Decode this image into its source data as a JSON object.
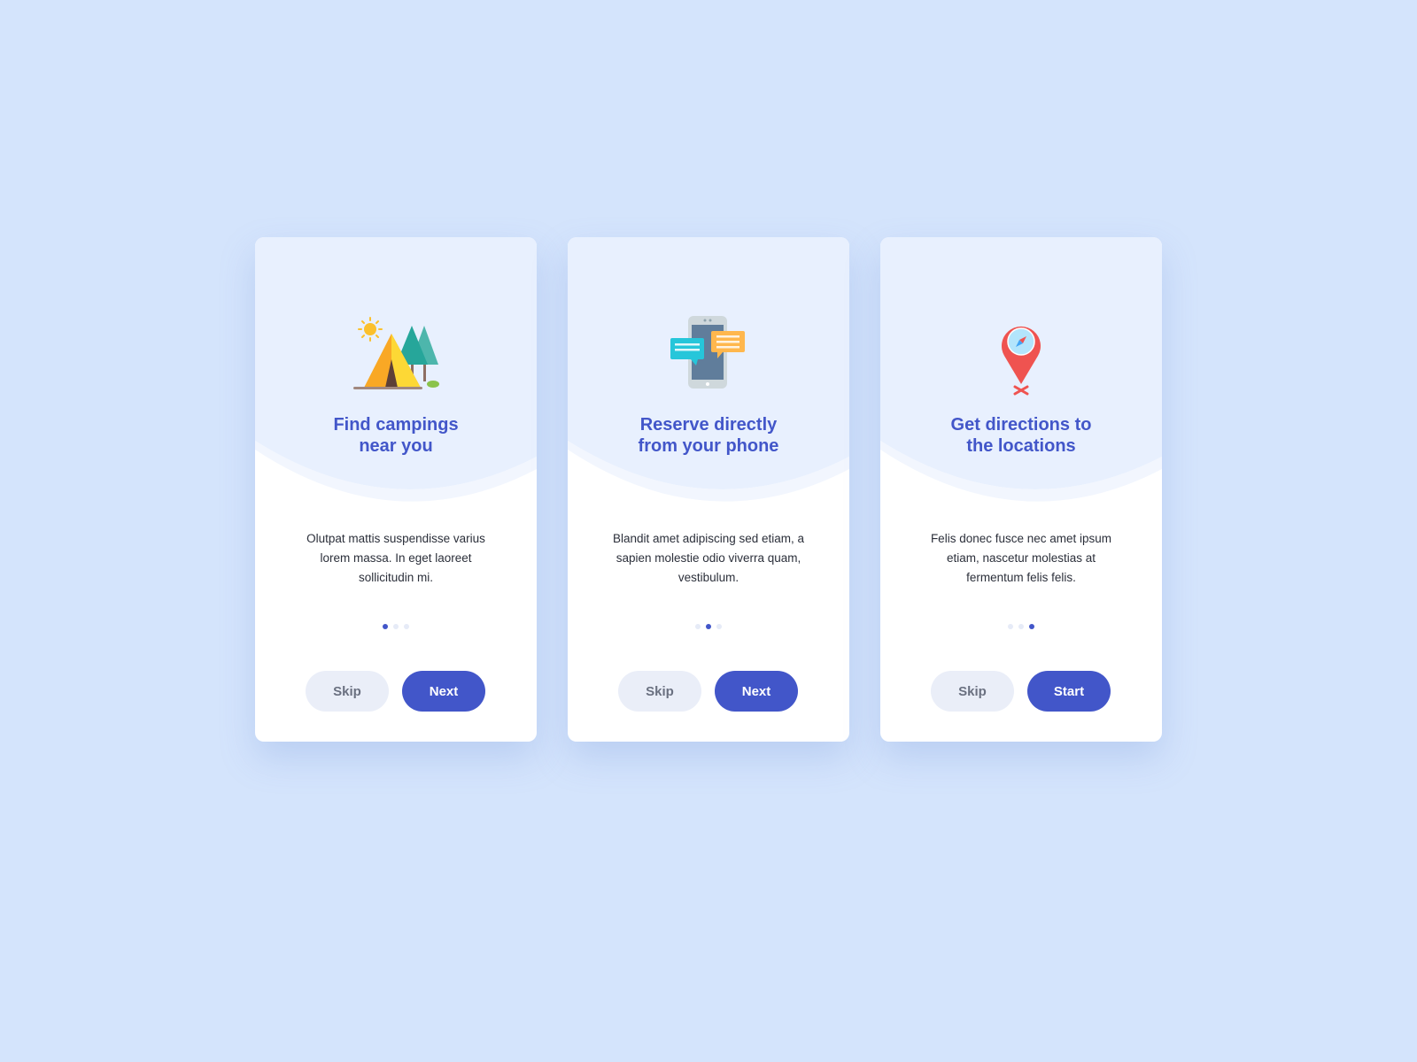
{
  "colors": {
    "page_background": "#d4e4fc",
    "card_background": "#ffffff",
    "card_header_background": "#e8f0fe",
    "accent": "#4256c9",
    "skip_button_background": "#eaeef8",
    "skip_button_text": "#6a7080",
    "body_text": "#2b2f3a",
    "dot_inactive": "#e6ebf7"
  },
  "cards": [
    {
      "icon": "camping-tent-icon",
      "title_line1": "Find campings",
      "title_line2": "near you",
      "body": "Olutpat mattis suspendisse varius lorem massa. In eget laoreet sollicitudin mi.",
      "active_dot": 1,
      "skip_label": "Skip",
      "primary_label": "Next"
    },
    {
      "icon": "phone-chat-icon",
      "title_line1": "Reserve directly",
      "title_line2": "from your phone",
      "body": "Blandit amet adipiscing sed etiam, a sapien molestie odio viverra quam, vestibulum.",
      "active_dot": 2,
      "skip_label": "Skip",
      "primary_label": "Next"
    },
    {
      "icon": "map-pin-compass-icon",
      "title_line1": "Get directions to",
      "title_line2": "the locations",
      "body": "Felis donec fusce nec amet ipsum etiam, nascetur molestias at fermentum felis felis.",
      "active_dot": 3,
      "skip_label": "Skip",
      "primary_label": "Start"
    }
  ]
}
